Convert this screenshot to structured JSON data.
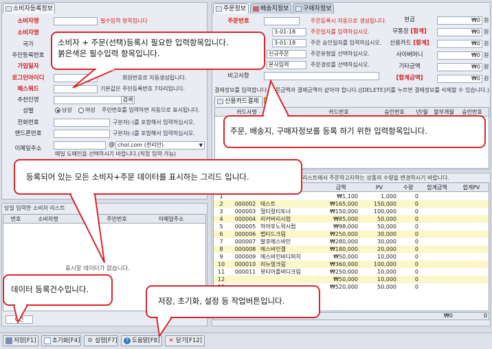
{
  "tabs_left": {
    "customer_reg": "소비자등록정보"
  },
  "tabs_right": {
    "order": "주문정보",
    "ship": "배송지정보",
    "buyer": "구매자정보"
  },
  "customer_form": {
    "consumer_name_label": "소비자명",
    "consumer_name_hint": "필수입력 항목입니다",
    "consumer_type_label": "소비자명",
    "country_label": "국가",
    "resident_no_label": "주민등록번호",
    "sponsor_label": "가입일자",
    "login_id_label": "로그인아이디",
    "login_id_hint": "회원번호로 자동생성됩니다.",
    "password_label": "패스워드",
    "password_hint": "기본값은 주민등록번호 7자리입니다.",
    "referrer_label": "추천인명",
    "search_btn": "검색",
    "gender_label": "성별",
    "gender_male": "남성",
    "gender_female": "여성",
    "gender_hint": "주민번호를 입력하면 자동으로 표시됩니다.",
    "phone_label": "전화번호",
    "phone_hint": "구분자(-)를 포함해서 입력하십시오.",
    "mobile_label": "핸드폰번호",
    "mobile_hint": "구분자(-)를 포함해서 입력하십시오.",
    "email_label": "이메일주소",
    "email_domain": "chol.com (천리안)",
    "email_hint": "메일 도메인을 선택하시기 바랍니다.(직접 입력 가능)"
  },
  "order_form": {
    "order_no_label": "주문번호",
    "order_no_hint": "주문등록시 자동으로 생성됩니다.",
    "order_date_value": "3-01-18",
    "order_date_hint": "주문일자를 입력하십시오.",
    "approve_date_value": "3-01-18",
    "approve_date_hint": "주문 승인일자를 입력하십시오.",
    "order_type_value": "신규주문",
    "order_type_hint": "주문유형을 선택하십시오.",
    "order_route_value": "본사입력",
    "order_route_hint": "주문경로를 선택하십시오.",
    "memo_label": "비고사항",
    "payment_notice": "결제정보를 입력합니다. 주문금액과 결제금액이 같아야 합니다.([DELETE]키를 누르면 결제정보를 삭제할 수 있습니다.)",
    "card_tab": "신용카드결제",
    "card_cols": [
      "카드사명",
      "카드번호",
      "승인번호",
      "년/월",
      "할부개월",
      "승인번호"
    ]
  },
  "payment": {
    "cash_label": "현금",
    "cash_value": "₩0",
    "unit": "원",
    "bank_label": "무통장",
    "bank_tag": "[합계]",
    "bank_value": "₩0",
    "card_label": "신용카드",
    "card_tag": "[합계]",
    "card_value": "₩0",
    "cyber_label": "사이버머니",
    "cyber_value": "₩0",
    "etc_label": "기타금액",
    "etc_value": "₩0",
    "total_label": "[합계금액]",
    "total_value": "₩0"
  },
  "left_list": {
    "title": "당일 입력한 소비자 리스트",
    "columns": [
      "번호",
      "소비자명",
      "주민번호",
      "이메일주소"
    ],
    "empty_text": "표시할 데이터가 없습니다.",
    "count_text": "0건"
  },
  "product_grid": {
    "notice": "리스트에서 주문하고자하는 상품의 수량을 변경하시기 바랍니다.",
    "columns": [
      "",
      "",
      "",
      "금액",
      "PV",
      "수량",
      "합계금액",
      "합계PV"
    ],
    "rows": [
      {
        "no": "1",
        "code": "",
        "name": "",
        "price": "₩1,100",
        "pv": "1,000",
        "qty": "0"
      },
      {
        "no": "2",
        "code": "000002",
        "name": "테스트",
        "price": "₩165,000",
        "pv": "150,000",
        "qty": "0"
      },
      {
        "no": "3",
        "code": "000003",
        "name": "멀티컬티토너",
        "price": "₩150,000",
        "pv": "100,000",
        "qty": "0"
      },
      {
        "no": "4",
        "code": "000004",
        "name": "리커버리시럽",
        "price": "₩85,000",
        "pv": "50,000",
        "qty": "0"
      },
      {
        "no": "5",
        "code": "000005",
        "name": "하야후노락시럽",
        "price": "₩98,000",
        "pv": "50,000",
        "qty": "0"
      },
      {
        "no": "6",
        "code": "000006",
        "name": "펩티드크림",
        "price": "₩250,000",
        "pv": "30,000",
        "qty": "0"
      },
      {
        "no": "7",
        "code": "000007",
        "name": "발포에스바인",
        "price": "₩280,000",
        "pv": "30,000",
        "qty": "0"
      },
      {
        "no": "8",
        "code": "000008",
        "name": "에스바인겔",
        "price": "₩180,000",
        "pv": "20,000",
        "qty": "0"
      },
      {
        "no": "9",
        "code": "000009",
        "name": "에스바인바디퍼치",
        "price": "₩50,000",
        "pv": "10,000",
        "qty": "0"
      },
      {
        "no": "10",
        "code": "000010",
        "name": "리뉴얼크림",
        "price": "₩360,000",
        "pv": "100,000",
        "qty": "0"
      },
      {
        "no": "11",
        "code": "000011",
        "name": "뷰티어플바디크림",
        "price": "₩250,000",
        "pv": "10,000",
        "qty": "0"
      },
      {
        "no": "12",
        "code": "",
        "name": "",
        "price": "₩50,000",
        "pv": "10,000",
        "qty": "0"
      },
      {
        "no": "13",
        "code": "",
        "name": "",
        "price": "₩520,000",
        "pv": "50,000",
        "qty": "0"
      }
    ],
    "footer_total_amount": "₩0",
    "footer_total_pv": "0"
  },
  "toolbar": {
    "save": "저장[F1]",
    "reset": "초기화[F4]",
    "settings": "설정[F7]",
    "help": "도움말[F8]",
    "close": "닫기[F12]"
  },
  "callouts": {
    "form_note": "소비자 + 주문(선택)등록시 필요한 입력항목입니다.\n붉은색은 필수입력 항목입니다.",
    "order_note": "주문, 배송지, 구매자정보를 등록 하기 위한 입력항목입니다.",
    "grid_note": "등록되어 있는 모든 소비자+주문 데이터를 표시하는 그리드 입니다.",
    "count_note": "데이터 등록건수입니다.",
    "toolbar_note": "저장, 초기화, 설정 등 작업버튼입니다."
  },
  "colors": {
    "required": "#d21b1b",
    "callout_border": "#d7252c",
    "row_highlight": "#fbf7c8"
  }
}
